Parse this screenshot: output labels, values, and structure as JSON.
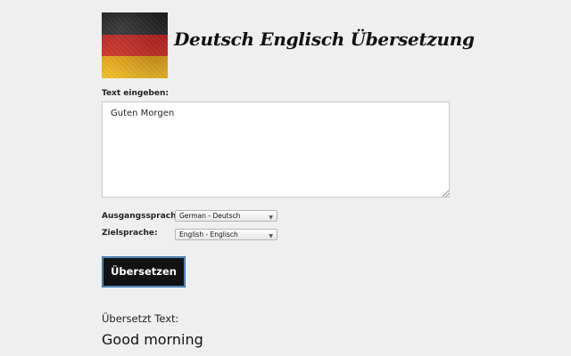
{
  "header": {
    "title": "Deutsch Englisch Übersetzung",
    "flag_icon": "german-flag-icon",
    "flag_colors": [
      "#1a1a1a",
      "#c62b23",
      "#efb226"
    ]
  },
  "form": {
    "input_label": "Text eingeben:",
    "input_value": "Guten Morgen",
    "source_label": "Ausgangssprache:",
    "source_value": "German - Deutsch",
    "target_label": "Zielsprache:",
    "target_value": "English - Englisch",
    "translate_button": "Übersetzen"
  },
  "result": {
    "label": "Übersetzt Text:",
    "text": "Good morning"
  }
}
